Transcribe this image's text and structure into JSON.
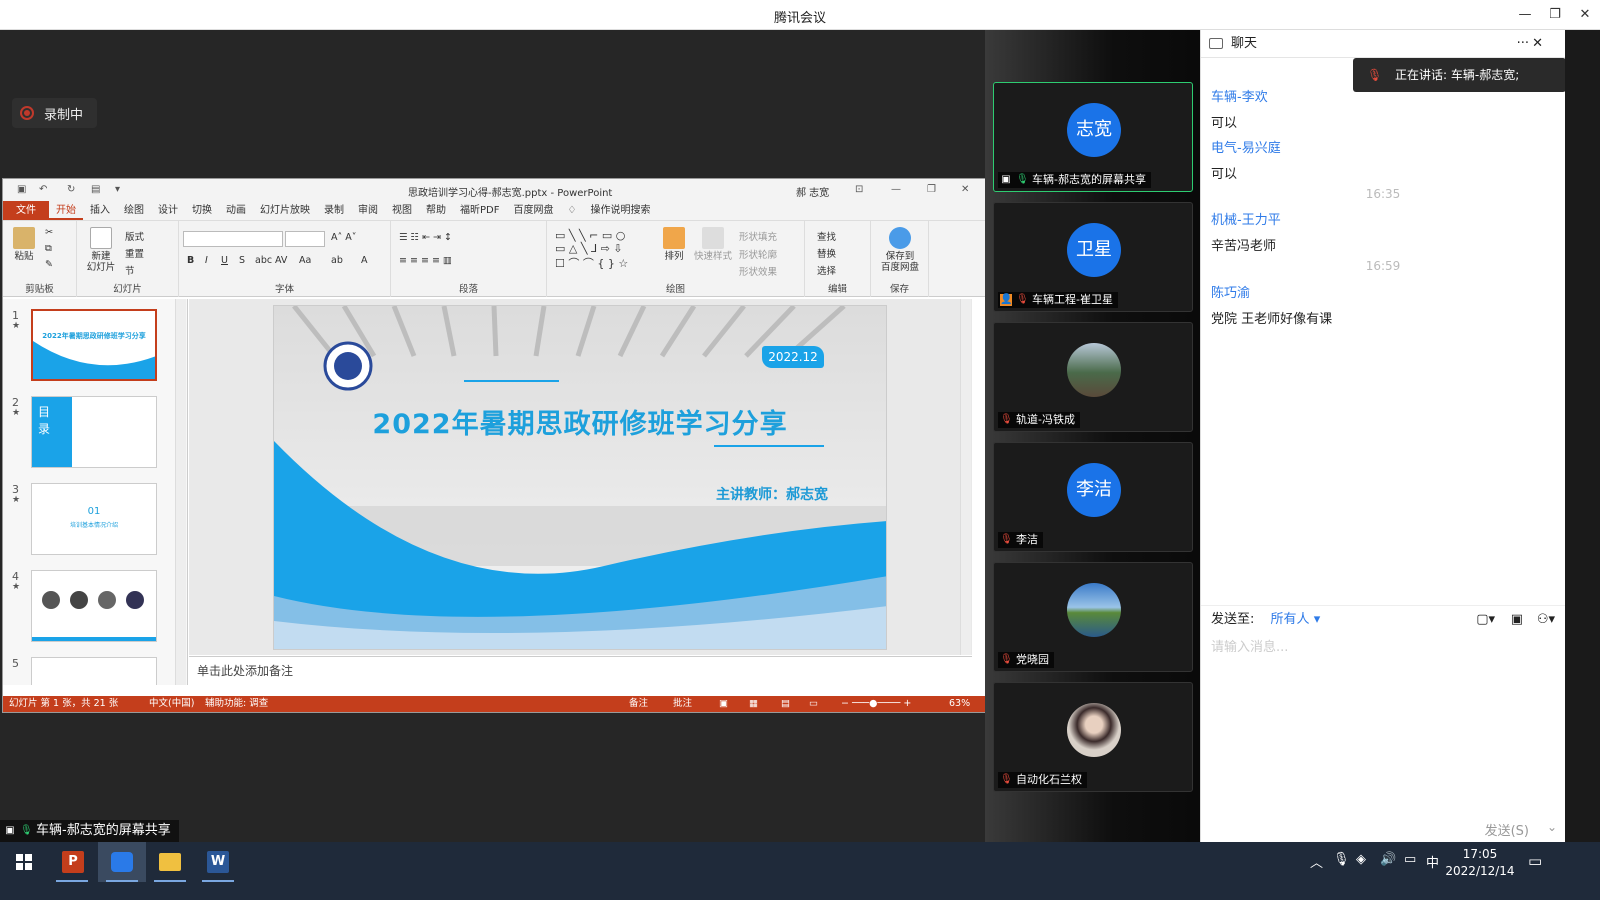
{
  "app": {
    "title": "腾讯会议"
  },
  "recording": {
    "label": "录制中"
  },
  "ppt": {
    "doc_title": "思政培训学习心得-郝志宽.pptx - PowerPoint",
    "user": "郝 志宽",
    "menu": [
      "文件",
      "开始",
      "插入",
      "绘图",
      "设计",
      "切换",
      "动画",
      "幻灯片放映",
      "录制",
      "审阅",
      "视图",
      "帮助",
      "福昕PDF",
      "百度网盘"
    ],
    "search": "操作说明搜索",
    "ribbon": {
      "paste": "粘贴",
      "new_slide": "新建\n幻灯片",
      "layout": "版式",
      "reset": "重置",
      "section": "节",
      "groups": [
        "剪贴板",
        "幻灯片",
        "字体",
        "段落",
        "绘图",
        "编辑",
        "保存"
      ],
      "arrange": "排列",
      "quick_style": "快速样式",
      "shape_fill": "形状填充",
      "shape_outline": "形状轮廓",
      "shape_effect": "形状效果",
      "find": "查找",
      "replace": "替换",
      "select": "选择",
      "save_baidu": "保存到\n百度网盘"
    },
    "slides": [
      "1",
      "2",
      "3",
      "4",
      "5"
    ],
    "slide": {
      "date": "2022.12",
      "title": "2022年暑期思政研修班学习分享",
      "teacher": "主讲教师：郝志宽"
    },
    "thumb_texts": {
      "t1": "2022年暑期思政研修班学习分享",
      "t2a": "目",
      "t2b": "录",
      "t3a": "01",
      "t3b": "培训基本情况介绍"
    },
    "notes": "单击此处添加备注",
    "status": {
      "slide_info": "幻灯片 第 1 张，共 21 张",
      "lang": "中文(中国)",
      "access": "辅助功能: 调查",
      "notes": "备注",
      "comments": "批注",
      "zoom": "63%"
    }
  },
  "share_label": "车辆-郝志宽的屏幕共享",
  "participants": [
    {
      "avatar": "志宽",
      "name": "车辆-郝志宽的屏幕共享",
      "color": "#1a73e8"
    },
    {
      "avatar": "卫星",
      "name": "车辆工程-崔卫星",
      "color": "#1a73e8"
    },
    {
      "avatar": "",
      "name": "轨道-冯铁成",
      "color": "#6a7f6a"
    },
    {
      "avatar": "李洁",
      "name": "李洁",
      "color": "#1a73e8"
    },
    {
      "avatar": "",
      "name": "党晓园",
      "color": "#4a90c8"
    },
    {
      "avatar": "",
      "name": "自动化石兰权",
      "color": "#b9a690"
    }
  ],
  "chat": {
    "title": "聊天",
    "speaking": "正在讲话: 车辆-郝志宽;",
    "messages": [
      {
        "name": "车辆-李欢",
        "text": "可以"
      },
      {
        "name": "电气-易兴庭",
        "text": "可以"
      },
      {
        "time": "16:35"
      },
      {
        "name": "机械-王力平",
        "text": "辛苦冯老师"
      },
      {
        "time": "16:59"
      },
      {
        "name": "陈巧渝",
        "text": "党院 王老师好像有课"
      }
    ],
    "send_to_label": "发送至:",
    "send_to_value": "所有人",
    "placeholder": "请输入消息...",
    "send_button": "发送(S)"
  },
  "taskbar": {
    "time": "17:05",
    "date": "2022/12/14",
    "ime": "中"
  },
  "colors": {
    "accent": "#1a73e8",
    "ppt_red": "#c43e1c",
    "slide_blue": "#1da0dc"
  }
}
